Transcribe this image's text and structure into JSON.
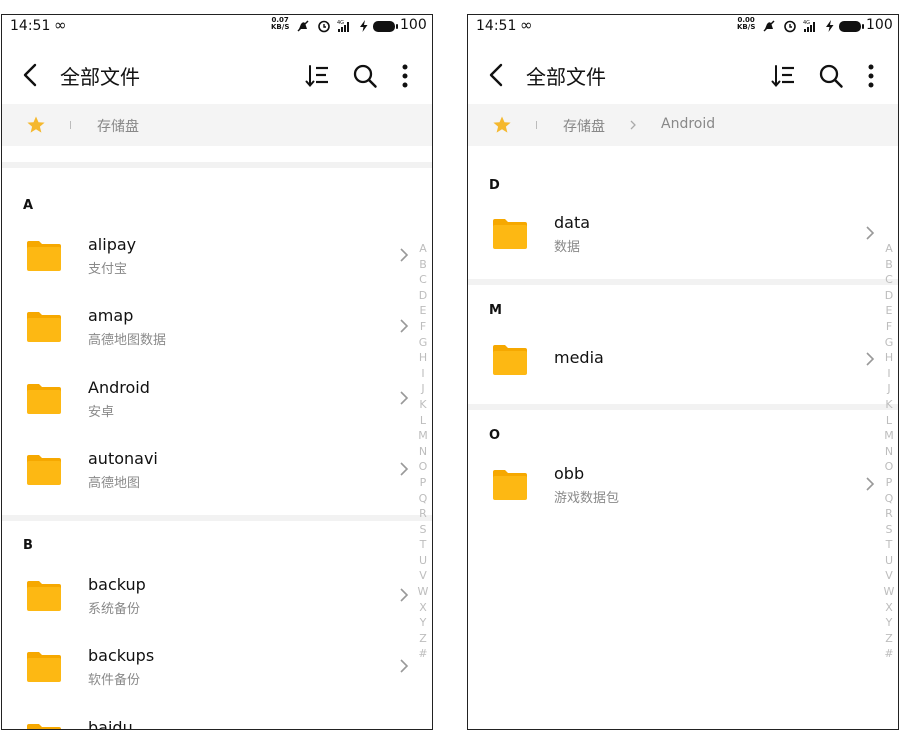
{
  "left": {
    "status": {
      "time": "14:51",
      "speed_top": "0.07",
      "speed_bottom": "KB/S",
      "battery": "100"
    },
    "toolbar": {
      "title": "全部文件"
    },
    "breadcrumb": {
      "root": "存储盘"
    },
    "sections": [
      {
        "letter": "A",
        "items": [
          {
            "name": "alipay",
            "desc": "支付宝"
          },
          {
            "name": "amap",
            "desc": "高德地图数据"
          },
          {
            "name": "Android",
            "desc": "安卓"
          },
          {
            "name": "autonavi",
            "desc": "高德地图"
          }
        ]
      },
      {
        "letter": "B",
        "items": [
          {
            "name": "backup",
            "desc": "系统备份"
          },
          {
            "name": "backups",
            "desc": "软件备份"
          },
          {
            "name": "baidu",
            "desc": ""
          }
        ]
      }
    ]
  },
  "right": {
    "status": {
      "time": "14:51",
      "speed_top": "0.00",
      "speed_bottom": "KB/S",
      "battery": "100"
    },
    "toolbar": {
      "title": "全部文件"
    },
    "breadcrumb": {
      "root": "存储盘",
      "sub": "Android"
    },
    "sections": [
      {
        "letter": "D",
        "items": [
          {
            "name": "data",
            "desc": "数据"
          }
        ]
      },
      {
        "letter": "M",
        "items": [
          {
            "name": "media",
            "desc": ""
          }
        ]
      },
      {
        "letter": "O",
        "items": [
          {
            "name": "obb",
            "desc": "游戏数据包"
          }
        ]
      }
    ]
  },
  "index_letters": [
    "A",
    "B",
    "C",
    "D",
    "E",
    "F",
    "G",
    "H",
    "I",
    "J",
    "K",
    "L",
    "M",
    "N",
    "O",
    "P",
    "Q",
    "R",
    "S",
    "T",
    "U",
    "V",
    "W",
    "X",
    "Y",
    "Z",
    "#"
  ],
  "colors": {
    "folder": "#FDB813",
    "folder_tab": "#F6A800",
    "star": "#F5B82E",
    "breadcrumb_bg": "#F4F4F4"
  }
}
